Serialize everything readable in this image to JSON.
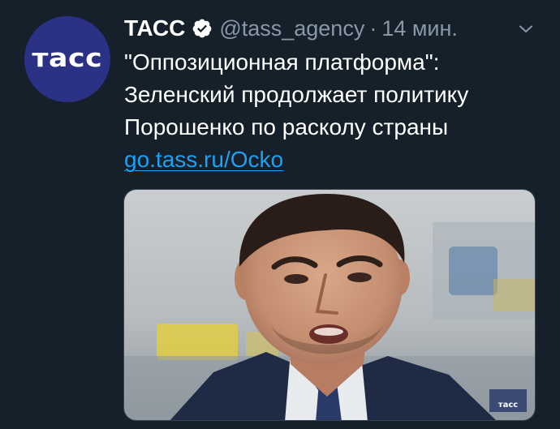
{
  "tweet": {
    "avatar_text": "тасс",
    "display_name": "ТАСС",
    "verified_icon": "verified-badge-icon",
    "handle": "@tass_agency",
    "separator": "·",
    "time": "14 мин.",
    "menu_icon": "chevron-down-icon",
    "text_lines": [
      "\"Оппозиционная платформа\":",
      "Зеленский продолжает политику",
      "Порошенко по расколу страны"
    ],
    "link": "go.tass.ru/Ocko",
    "media": {
      "watermark": "тасс"
    }
  },
  "colors": {
    "background": "#15202b",
    "text": "#ffffff",
    "secondary": "#8899a6",
    "link": "#1da1f2",
    "avatar": "#2b3285"
  }
}
